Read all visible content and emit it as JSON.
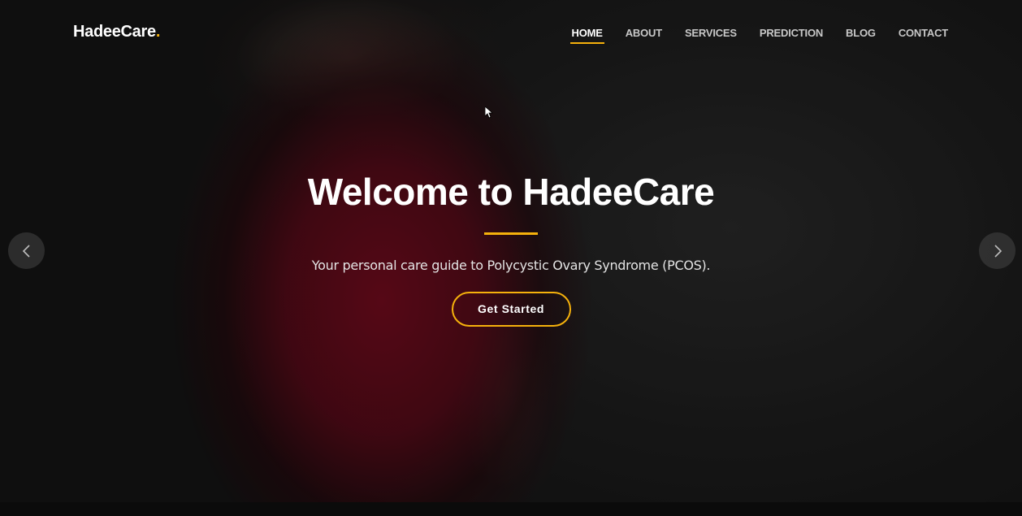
{
  "header": {
    "logo_text": "HadeeCare",
    "logo_dot": ".",
    "nav": [
      {
        "label": "HOME",
        "active": true
      },
      {
        "label": "ABOUT"
      },
      {
        "label": "SERVICES"
      },
      {
        "label": "PREDICTION"
      },
      {
        "label": "BLOG"
      },
      {
        "label": "CONTACT"
      }
    ]
  },
  "hero": {
    "title": "Welcome to HadeeCare",
    "subtitle": "Your personal care guide to Polycystic Ovary Syndrome (PCOS).",
    "cta_label": "Get Started"
  },
  "carousel": {
    "prev_icon": "chevron-left-icon",
    "next_icon": "chevron-right-icon"
  },
  "colors": {
    "accent": "#f5b10c",
    "text": "#ffffff"
  }
}
